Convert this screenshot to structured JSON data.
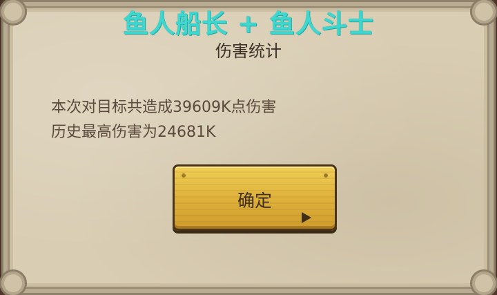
{
  "overlay_title": "鱼人船长 + 鱼人斗士",
  "dialog": {
    "title": "伤害统计",
    "message_lines": [
      "本次对目标共造成39609K点伤害",
      "历史最高伤害为24681K"
    ],
    "confirm_label": "确定"
  },
  "colors": {
    "overlay_title": "#3ed6cf",
    "panel": "#d9cdb3",
    "button": "#e1b53d"
  }
}
